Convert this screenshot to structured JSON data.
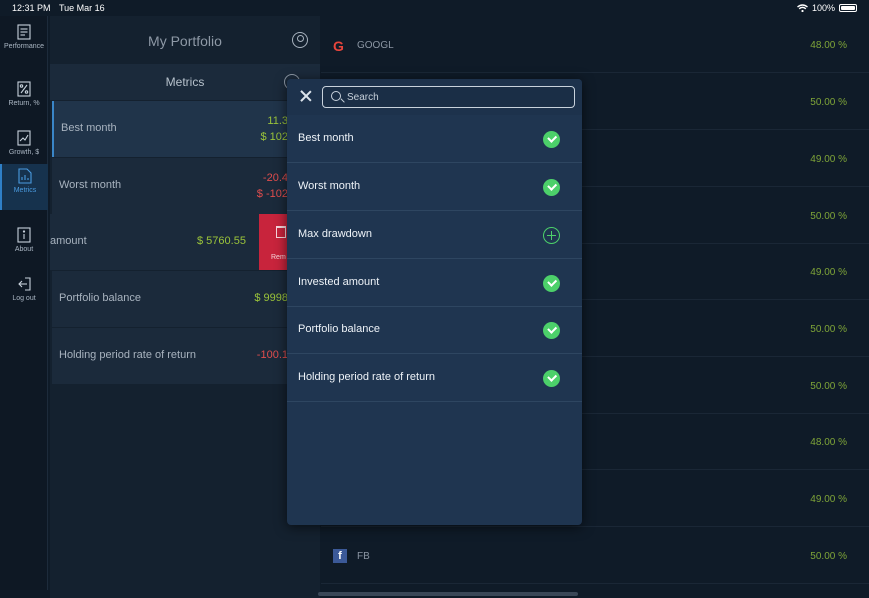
{
  "status_bar": {
    "time": "12:31 PM",
    "date": "Tue Mar 16",
    "battery": "100%",
    "icons": [
      "wifi-icon",
      "battery-icon"
    ]
  },
  "sidebar": {
    "items": [
      {
        "label": "Performance",
        "icon": "document-icon"
      },
      {
        "label": "Return, %",
        "icon": "percent-chart-icon"
      },
      {
        "label": "Growth, $",
        "icon": "growth-chart-icon"
      },
      {
        "label": "Metrics",
        "icon": "metrics-icon",
        "active": true
      },
      {
        "label": "About",
        "icon": "info-icon"
      },
      {
        "label": "Log out",
        "icon": "logout-icon"
      }
    ]
  },
  "portfolio": {
    "title": "My Portfolio",
    "metrics_tab": "Metrics",
    "rows": [
      {
        "name": "Best month",
        "value1": "11.3",
        "value2": "$ 102"
      },
      {
        "name": "Worst month",
        "value1": "-20.4",
        "value2": "$ -102"
      },
      {
        "name": "amount",
        "value1": "$ 5760.55",
        "remove_label": "Rem"
      },
      {
        "name": "Portfolio balance",
        "value1": "$ 9998"
      },
      {
        "name": "Holding period rate of return",
        "value1": "-100.1"
      }
    ]
  },
  "holdings": {
    "rows": [
      {
        "ticker": "GOOGL",
        "logo": "G",
        "percent": "48.00 %"
      },
      {
        "ticker": "",
        "percent": "50.00 %"
      },
      {
        "ticker": "",
        "percent": "49.00 %"
      },
      {
        "ticker": "",
        "percent": "50.00 %"
      },
      {
        "ticker": "",
        "percent": "49.00 %"
      },
      {
        "ticker": "",
        "percent": "50.00 %"
      },
      {
        "ticker": "",
        "percent": "50.00 %"
      },
      {
        "ticker": "",
        "percent": "48.00 %"
      },
      {
        "ticker": "",
        "percent": "49.00 %"
      },
      {
        "ticker": "FB",
        "logo": "f",
        "percent": "50.00 %"
      }
    ]
  },
  "modal": {
    "search_placeholder": "Search",
    "options": [
      {
        "label": "Best month",
        "state": "selected"
      },
      {
        "label": "Worst month",
        "state": "selected"
      },
      {
        "label": "Max drawdown",
        "state": "add"
      },
      {
        "label": "Invested amount",
        "state": "selected"
      },
      {
        "label": "Portfolio balance",
        "state": "selected"
      },
      {
        "label": "Holding period rate of return",
        "state": "selected"
      }
    ]
  },
  "colors": {
    "background": "#0f1b28",
    "panel": "#1b2a3b",
    "modal": "#1f3550",
    "positive": "#9bc43a",
    "negative": "#e04d4d",
    "check": "#4cd06a",
    "remove": "#c8243c",
    "accent": "#2f7fc6"
  }
}
